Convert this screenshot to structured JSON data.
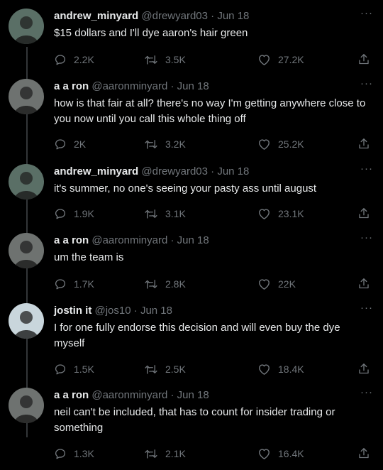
{
  "tweets": [
    {
      "name": "andrew_minyard",
      "handle": "@drewyard03",
      "date": "Jun 18",
      "text": "$15 dollars and I'll dye aaron's hair green",
      "replies": "2.2K",
      "retweets": "3.5K",
      "likes": "27.2K",
      "avatar_color": "#5a6f66"
    },
    {
      "name": "a a ron",
      "handle": "@aaronminyard",
      "date": "Jun 18",
      "text": "how is that fair at all? there's no way I'm getting anywhere close to you now until you call this whole thing off",
      "replies": "2K",
      "retweets": "3.2K",
      "likes": "25.2K",
      "avatar_color": "#6e7270"
    },
    {
      "name": "andrew_minyard",
      "handle": "@drewyard03",
      "date": "Jun 18",
      "text": "it's summer, no one's seeing your pasty ass until august",
      "replies": "1.9K",
      "retweets": "3.1K",
      "likes": "23.1K",
      "avatar_color": "#5a6f66"
    },
    {
      "name": "a a ron",
      "handle": "@aaronminyard",
      "date": "Jun 18",
      "text": "um the team is",
      "replies": "1.7K",
      "retweets": "2.8K",
      "likes": "22K",
      "avatar_color": "#6e7270"
    },
    {
      "name": "jostin it",
      "handle": "@jos10",
      "date": "Jun 18",
      "text": "I for one fully endorse this decision and will even buy the dye myself",
      "replies": "1.5K",
      "retweets": "2.5K",
      "likes": "18.4K",
      "avatar_color": "#c9d6dc"
    },
    {
      "name": "a a ron",
      "handle": "@aaronminyard",
      "date": "Jun 18",
      "text": "neil can't be included, that has to count for insider trading or something",
      "replies": "1.3K",
      "retweets": "2.1K",
      "likes": "16.4K",
      "avatar_color": "#6e7270"
    }
  ],
  "separator": "·",
  "more_glyph": "···"
}
